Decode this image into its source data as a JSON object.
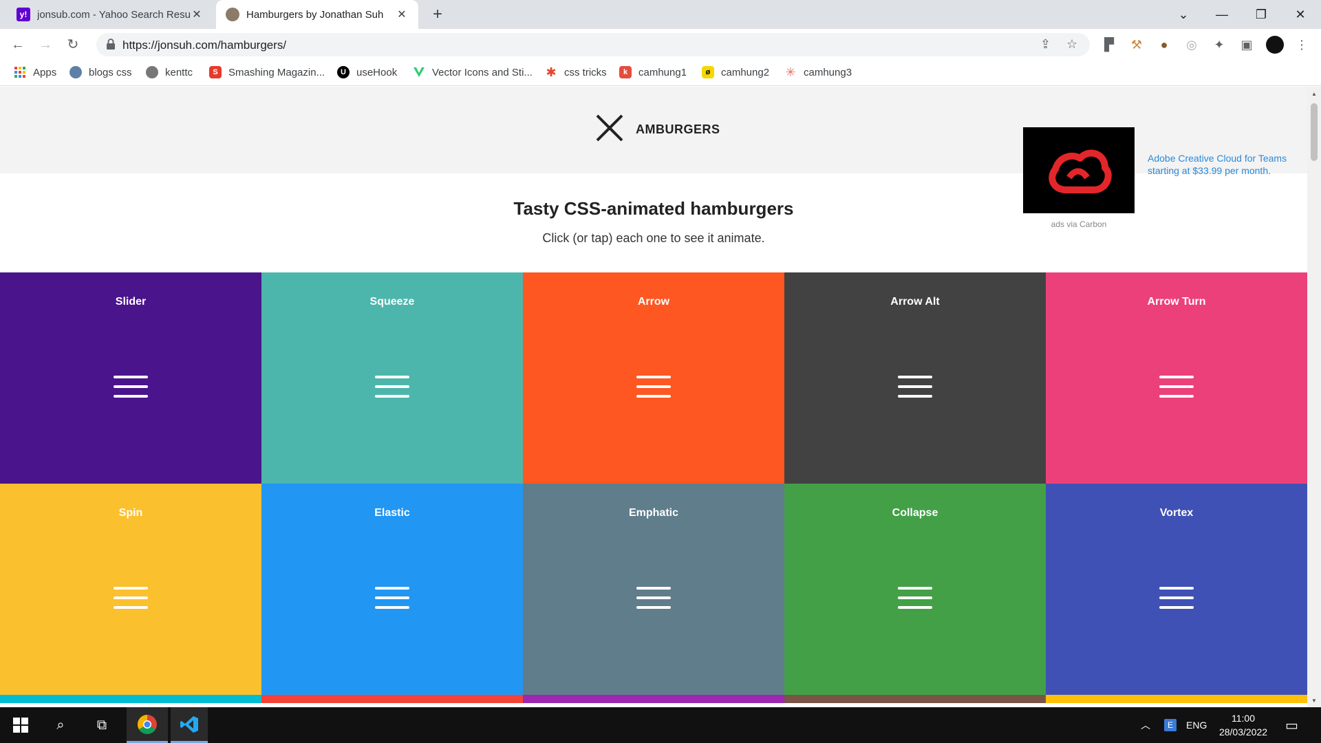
{
  "browser": {
    "tabs": [
      {
        "title": "jonsub.com - Yahoo Search Resul",
        "favicon": "yahoo-icon",
        "active": false
      },
      {
        "title": "Hamburgers by Jonathan Suh",
        "favicon": "avatar-icon",
        "active": true
      }
    ],
    "url": "https://jonsuh.com/hamburgers/",
    "bookmarks": [
      {
        "label": "Apps",
        "icon": "apps-grid-icon",
        "color": "#4285f4"
      },
      {
        "label": "blogs css",
        "icon": "globe-icon",
        "color": "#5f7fa8"
      },
      {
        "label": "kenttc",
        "icon": "koala-icon",
        "color": "#666666"
      },
      {
        "label": "Smashing Magazin...",
        "icon": "smashing-icon",
        "color": "#e53b2c"
      },
      {
        "label": "useHook",
        "icon": "usehook-icon",
        "color": "#000000"
      },
      {
        "label": "Vector Icons and Sti...",
        "icon": "vector-icon",
        "color": "#2ecc71"
      },
      {
        "label": "css tricks",
        "icon": "star-burst-icon",
        "color": "#e6452f"
      },
      {
        "label": "camhung1",
        "icon": "camhung1-icon",
        "color": "#e44c3c"
      },
      {
        "label": "camhung2",
        "icon": "camhung2-icon",
        "color": "#f4d800"
      },
      {
        "label": "camhung3",
        "icon": "camhung3-icon",
        "color": "#e8716b"
      }
    ]
  },
  "site": {
    "logo_text": "AMBURGERS",
    "title": "Tasty CSS-animated hamburgers",
    "subtitle": "Click (or tap) each one to see it animate.",
    "ad": {
      "text": "Adobe Creative Cloud for Teams starting at $33.99 per month.",
      "via": "ads via Carbon"
    },
    "tiles": [
      {
        "name": "Slider",
        "color": "#4a148c"
      },
      {
        "name": "Squeeze",
        "color": "#4db6ac"
      },
      {
        "name": "Arrow",
        "color": "#ff5722"
      },
      {
        "name": "Arrow Alt",
        "color": "#424242"
      },
      {
        "name": "Arrow Turn",
        "color": "#ec407a"
      },
      {
        "name": "Spin",
        "color": "#fbc02d"
      },
      {
        "name": "Elastic",
        "color": "#2196f3"
      },
      {
        "name": "Emphatic",
        "color": "#607d8b"
      },
      {
        "name": "Collapse",
        "color": "#43a047"
      },
      {
        "name": "Vortex",
        "color": "#3f51b5"
      }
    ],
    "next_row_colors": [
      "#00bcd4",
      "#f44336",
      "#9c27b0",
      "#795548",
      "#ffc107"
    ]
  },
  "taskbar": {
    "language": "ENG",
    "time": "11:00",
    "date": "28/03/2022"
  }
}
